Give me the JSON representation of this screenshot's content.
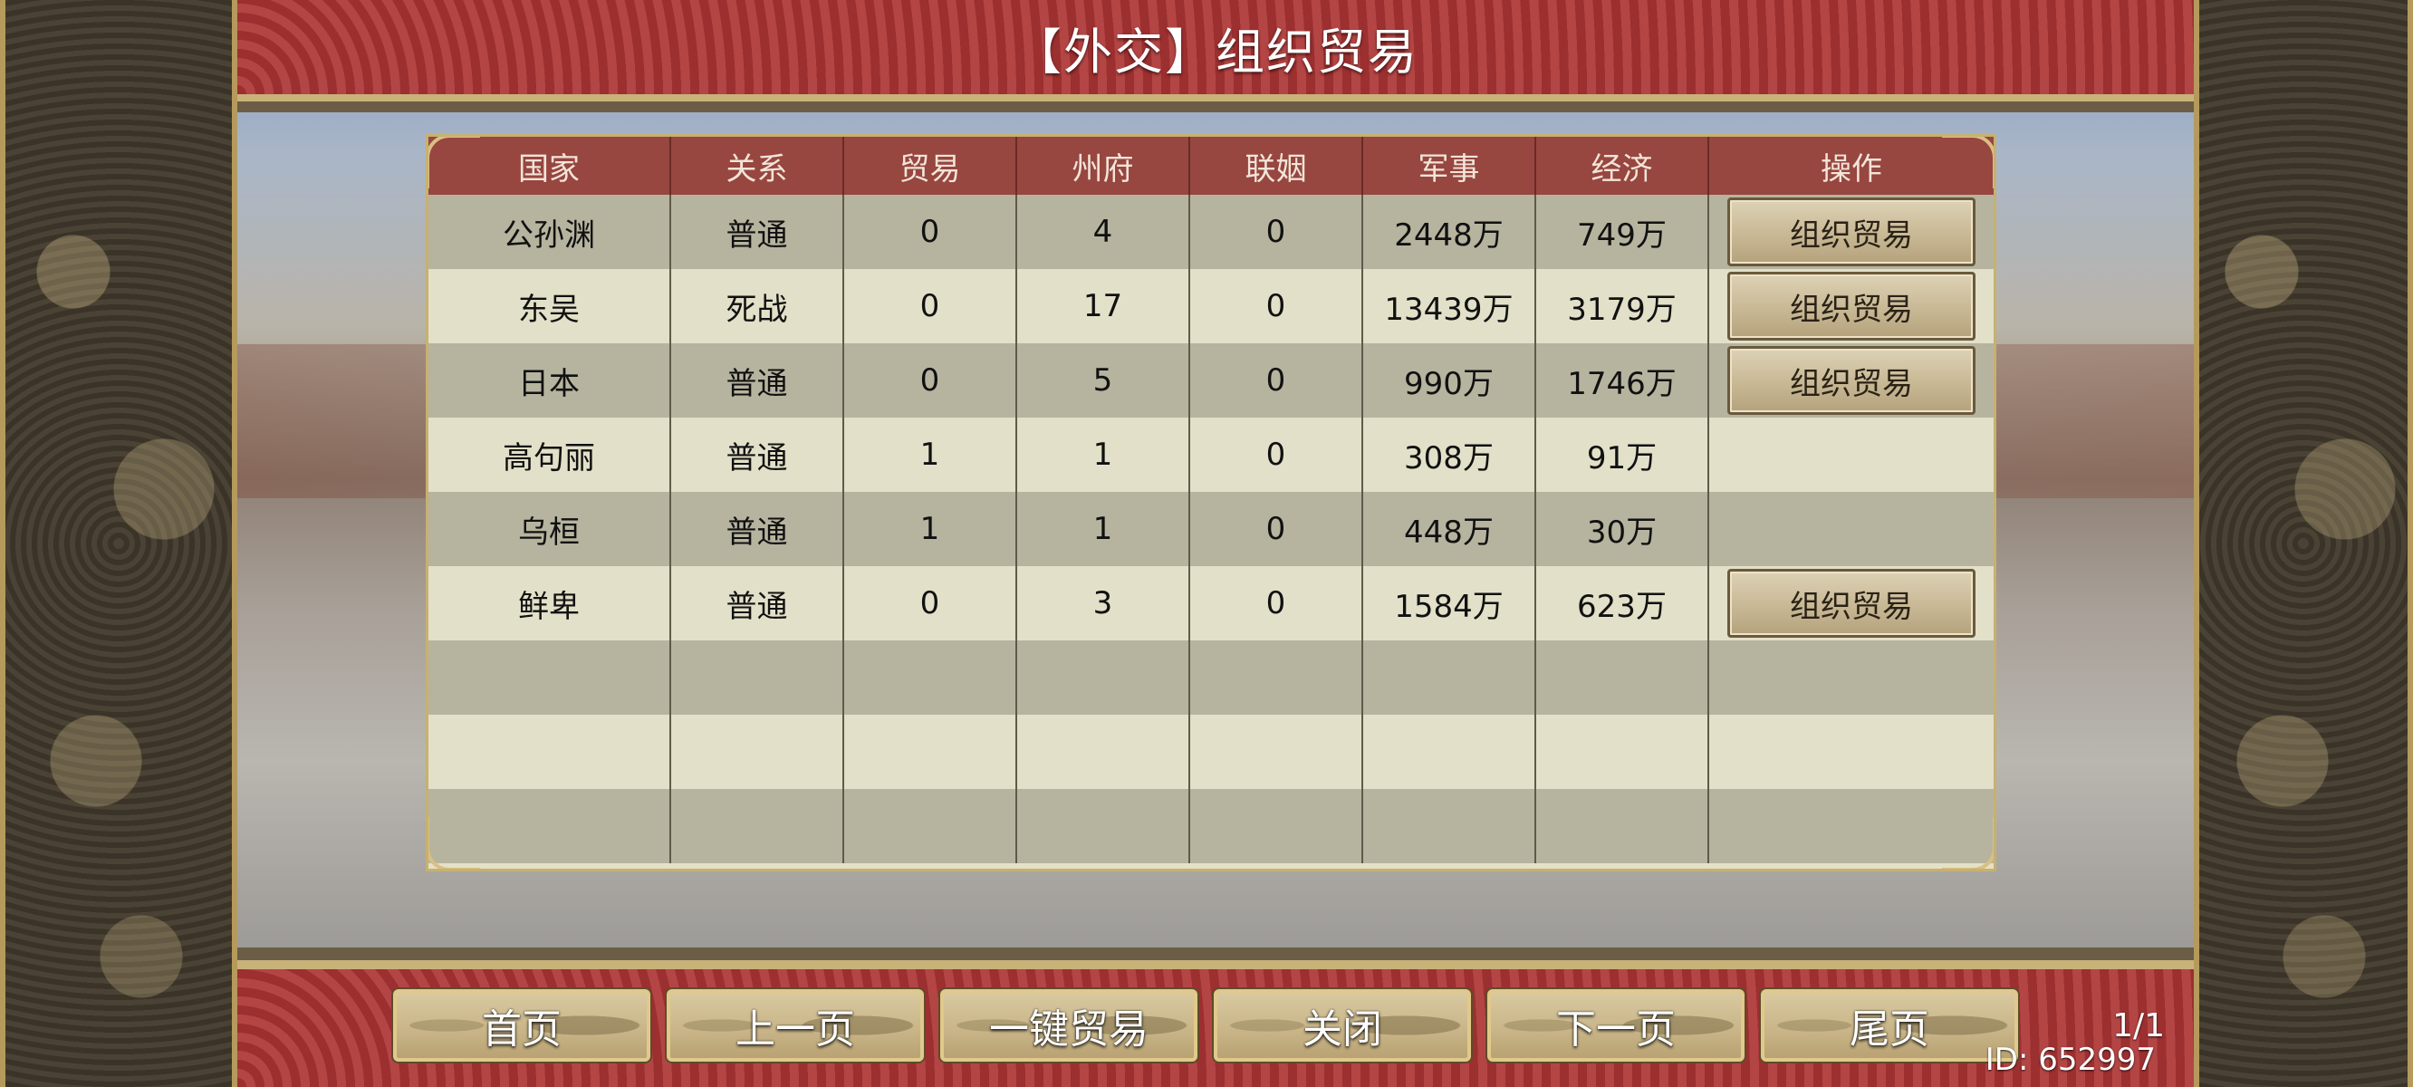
{
  "window": {
    "title": "【外交】组织贸易"
  },
  "table": {
    "headers": [
      "国家",
      "关系",
      "贸易",
      "州府",
      "联姻",
      "军事",
      "经济",
      "操作"
    ],
    "rows": [
      {
        "country": "公孙渊",
        "relation": "普通",
        "trade": "0",
        "provinces": "4",
        "marriage": "0",
        "military": "2448万",
        "economy": "749万",
        "action": "组织贸易"
      },
      {
        "country": "东吴",
        "relation": "死战",
        "trade": "0",
        "provinces": "17",
        "marriage": "0",
        "military": "13439万",
        "economy": "3179万",
        "action": "组织贸易"
      },
      {
        "country": "日本",
        "relation": "普通",
        "trade": "0",
        "provinces": "5",
        "marriage": "0",
        "military": "990万",
        "economy": "1746万",
        "action": "组织贸易"
      },
      {
        "country": "高句丽",
        "relation": "普通",
        "trade": "1",
        "provinces": "1",
        "marriage": "0",
        "military": "308万",
        "economy": "91万",
        "action": null
      },
      {
        "country": "乌桓",
        "relation": "普通",
        "trade": "1",
        "provinces": "1",
        "marriage": "0",
        "military": "448万",
        "economy": "30万",
        "action": null
      },
      {
        "country": "鲜卑",
        "relation": "普通",
        "trade": "0",
        "provinces": "3",
        "marriage": "0",
        "military": "1584万",
        "economy": "623万",
        "action": "组织贸易"
      }
    ],
    "empty_rows": 3
  },
  "footer": {
    "buttons": {
      "first": "首页",
      "prev": "上一页",
      "trade_all": "一键贸易",
      "close": "关闭",
      "next": "下一页",
      "last": "尾页"
    },
    "page_indicator": "1/1",
    "user_id": "ID: 652997"
  },
  "colors": {
    "header_bg": "#974640",
    "row_dark": "#b6b49f",
    "row_light": "#e2e0c8",
    "banner_red": "#9c2f2f",
    "gold_border": "#c9b27a"
  }
}
